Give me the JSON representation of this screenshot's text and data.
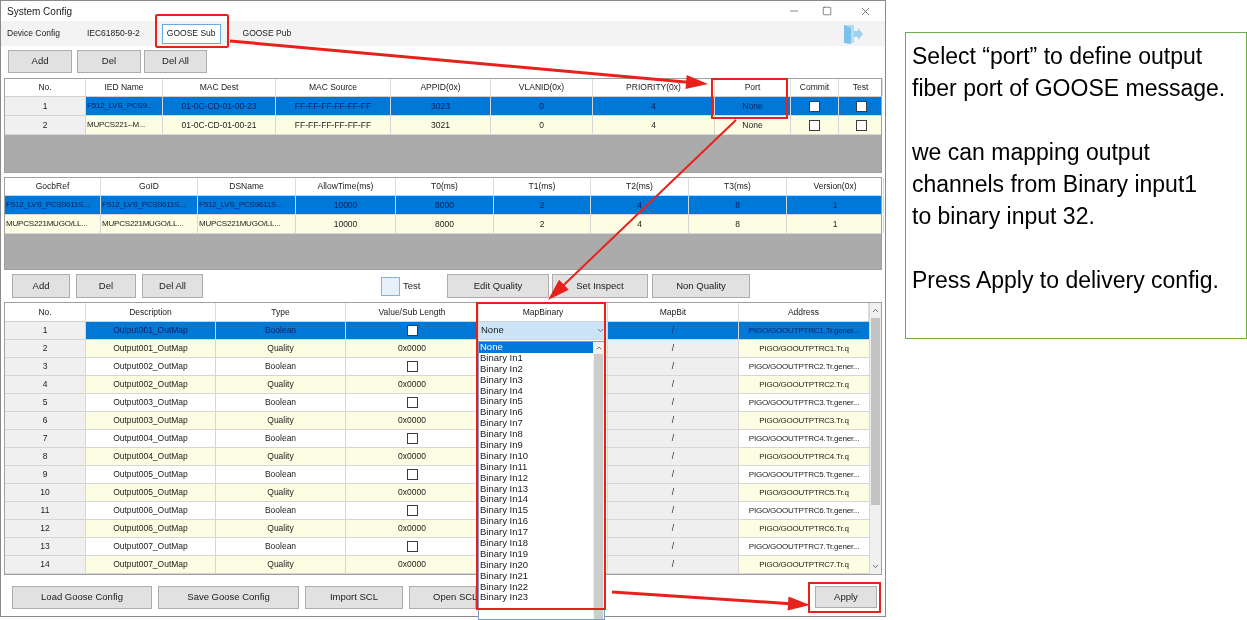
{
  "window": {
    "title": "System Config"
  },
  "tabs": [
    {
      "label": "Device Config",
      "selected": false
    },
    {
      "label": "IEC61850-9-2",
      "selected": false
    },
    {
      "label": "GOOSE Sub",
      "selected": true
    },
    {
      "label": "GOOSE Pub",
      "selected": false
    }
  ],
  "ied_toolbar": [
    "Add",
    "Del",
    "Del All"
  ],
  "ied_table": {
    "columns": [
      "No.",
      "IED Name",
      "MAC Dest",
      "MAC Source",
      "APPID(0x)",
      "VLANID(0x)",
      "PRIORITY(0x)",
      "Port",
      "Commit",
      "Test"
    ],
    "rows": [
      {
        "selected": true,
        "no": "1",
        "ied_name": "F512_LVS_PCS9...",
        "mac_dest": "01-0C-CD-01-00-23",
        "mac_source": "FF-FF-FF-FF-FF-FF",
        "appid": "3023",
        "vlanid": "0",
        "priority": "4",
        "port": "None",
        "commit": false,
        "test": false
      },
      {
        "selected": false,
        "no": "2",
        "ied_name": "MUPCS221--M...",
        "mac_dest": "01-0C-CD-01-00-21",
        "mac_source": "FF-FF-FF-FF-FF-FF",
        "appid": "3021",
        "vlanid": "0",
        "priority": "4",
        "port": "None",
        "commit": false,
        "test": false
      }
    ]
  },
  "gocb_table": {
    "columns": [
      "GocbRef",
      "GoID",
      "DSName",
      "AllowTime(ms)",
      "T0(ms)",
      "T1(ms)",
      "T2(ms)",
      "T3(ms)",
      "Version(0x)"
    ],
    "rows": [
      {
        "selected": true,
        "gocb_ref": "F512_LVS_PCS9611S...",
        "go_id": "F512_LVS_PCS9611S...",
        "ds_name": "F512_LVS_PCS9611S...",
        "allow_time": "10000",
        "t0": "8000",
        "t1": "2",
        "t2": "4",
        "t3": "8",
        "version": "1"
      },
      {
        "selected": false,
        "gocb_ref": "MUPCS221MUGO/LL...",
        "go_id": "MUPCS221MUGO/LL...",
        "ds_name": "MUPCS221MUGO/LL...",
        "allow_time": "10000",
        "t0": "8000",
        "t1": "2",
        "t2": "4",
        "t3": "8",
        "version": "1"
      }
    ]
  },
  "channel_toolbar": {
    "buttons": [
      "Add",
      "Del",
      "Del All"
    ],
    "test": {
      "label": "Test",
      "checked": false
    },
    "quality_buttons": [
      "Edit Quality",
      "Set Inspect",
      "Non Quality"
    ]
  },
  "channel_table": {
    "columns": [
      "No.",
      "Description",
      "Type",
      "Value/Sub Length",
      "MapBinary",
      "MapBit",
      "Address"
    ],
    "rows": [
      {
        "selected": true,
        "no": "1",
        "description": "Output001_OutMap",
        "type": "Boolean",
        "value": {
          "kind": "checkbox",
          "checked": false
        },
        "map_bit": "/",
        "address": "PIGO/GOOUTPTRC1.Tr.gener..."
      },
      {
        "selected": false,
        "no": "2",
        "description": "Output001_OutMap",
        "type": "Quality",
        "value": {
          "kind": "text",
          "text": "0x0000"
        },
        "map_bit": "/",
        "address": "PIGO/GOOUTPTRC1.Tr.q"
      },
      {
        "selected": false,
        "no": "3",
        "description": "Output002_OutMap",
        "type": "Boolean",
        "value": {
          "kind": "checkbox",
          "checked": false
        },
        "map_bit": "/",
        "address": "PIGO/GOOUTPTRC2.Tr.gener..."
      },
      {
        "selected": false,
        "no": "4",
        "description": "Output002_OutMap",
        "type": "Quality",
        "value": {
          "kind": "text",
          "text": "0x0000"
        },
        "map_bit": "/",
        "address": "PIGO/GOOUTPTRC2.Tr.q"
      },
      {
        "selected": false,
        "no": "5",
        "description": "Output003_OutMap",
        "type": "Boolean",
        "value": {
          "kind": "checkbox",
          "checked": false
        },
        "map_bit": "/",
        "address": "PIGO/GOOUTPTRC3.Tr.gener..."
      },
      {
        "selected": false,
        "no": "6",
        "description": "Output003_OutMap",
        "type": "Quality",
        "value": {
          "kind": "text",
          "text": "0x0000"
        },
        "map_bit": "/",
        "address": "PIGO/GOOUTPTRC3.Tr.q"
      },
      {
        "selected": false,
        "no": "7",
        "description": "Output004_OutMap",
        "type": "Boolean",
        "value": {
          "kind": "checkbox",
          "checked": false
        },
        "map_bit": "/",
        "address": "PIGO/GOOUTPTRC4.Tr.gener..."
      },
      {
        "selected": false,
        "no": "8",
        "description": "Output004_OutMap",
        "type": "Quality",
        "value": {
          "kind": "text",
          "text": "0x0000"
        },
        "map_bit": "/",
        "address": "PIGO/GOOUTPTRC4.Tr.q"
      },
      {
        "selected": false,
        "no": "9",
        "description": "Output005_OutMap",
        "type": "Boolean",
        "value": {
          "kind": "checkbox",
          "checked": false
        },
        "map_bit": "/",
        "address": "PIGO/GOOUTPTRC5.Tr.gener..."
      },
      {
        "selected": false,
        "no": "10",
        "description": "Output005_OutMap",
        "type": "Quality",
        "value": {
          "kind": "text",
          "text": "0x0000"
        },
        "map_bit": "/",
        "address": "PIGO/GOOUTPTRC5.Tr.q"
      },
      {
        "selected": false,
        "no": "11",
        "description": "Output006_OutMap",
        "type": "Boolean",
        "value": {
          "kind": "checkbox",
          "checked": false
        },
        "map_bit": "/",
        "address": "PIGO/GOOUTPTRC6.Tr.gener..."
      },
      {
        "selected": false,
        "no": "12",
        "description": "Output006_OutMap",
        "type": "Quality",
        "value": {
          "kind": "text",
          "text": "0x0000"
        },
        "map_bit": "/",
        "address": "PIGO/GOOUTPTRC6.Tr.q"
      },
      {
        "selected": false,
        "no": "13",
        "description": "Output007_OutMap",
        "type": "Boolean",
        "value": {
          "kind": "checkbox",
          "checked": false
        },
        "map_bit": "/",
        "address": "PIGO/GOOUTPTRC7.Tr.gener..."
      },
      {
        "selected": false,
        "no": "14",
        "description": "Output007_OutMap",
        "type": "Quality",
        "value": {
          "kind": "text",
          "text": "0x0000"
        },
        "map_bit": "/",
        "address": "PIGO/GOOUTPTRC7.Tr.q"
      }
    ]
  },
  "map_binary_dropdown": {
    "value": "None",
    "options": [
      {
        "label": "None",
        "selected": true
      },
      {
        "label": "Binary In1",
        "selected": false
      },
      {
        "label": "Binary In2",
        "selected": false
      },
      {
        "label": "Binary In3",
        "selected": false
      },
      {
        "label": "Binary In4",
        "selected": false
      },
      {
        "label": "Binary In5",
        "selected": false
      },
      {
        "label": "Binary In6",
        "selected": false
      },
      {
        "label": "Binary In7",
        "selected": false
      },
      {
        "label": "Binary In8",
        "selected": false
      },
      {
        "label": "Binary In9",
        "selected": false
      },
      {
        "label": "Binary In10",
        "selected": false
      },
      {
        "label": "Binary In11",
        "selected": false
      },
      {
        "label": "Binary In12",
        "selected": false
      },
      {
        "label": "Binary In13",
        "selected": false
      },
      {
        "label": "Binary In14",
        "selected": false
      },
      {
        "label": "Binary In15",
        "selected": false
      },
      {
        "label": "Binary In16",
        "selected": false
      },
      {
        "label": "Binary In17",
        "selected": false
      },
      {
        "label": "Binary In18",
        "selected": false
      },
      {
        "label": "Binary In19",
        "selected": false
      },
      {
        "label": "Binary In20",
        "selected": false
      },
      {
        "label": "Binary In21",
        "selected": false
      },
      {
        "label": "Binary In22",
        "selected": false
      },
      {
        "label": "Binary In23",
        "selected": false
      }
    ]
  },
  "bottom_buttons": [
    "Load Goose Config",
    "Save Goose Config",
    "Import SCL",
    "Open SCL"
  ],
  "apply_button": "Apply",
  "note": [
    "Select “port” to define output\nfiber port of GOOSE message.",
    "we can mapping output\nchannels from Binary input1\nto binary input 32.",
    "Press Apply to delivery config."
  ]
}
